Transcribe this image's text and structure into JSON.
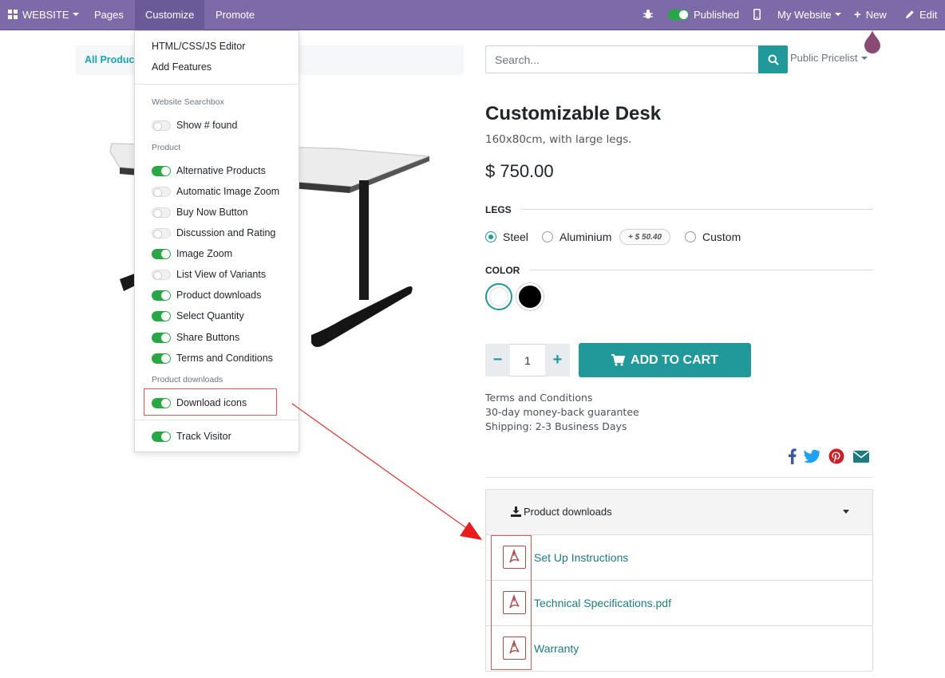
{
  "navbar": {
    "website_menu": "WEBSITE",
    "pages": "Pages",
    "customize": "Customize",
    "promote": "Promote",
    "published": "Published",
    "my_website": "My Website",
    "new": "New",
    "edit": "Edit"
  },
  "breadcrumb": {
    "label": "All Product"
  },
  "customize_menu": {
    "editor": "HTML/CSS/JS Editor",
    "add_features": "Add Features",
    "sections": [
      {
        "header": "Website Searchbox",
        "items": [
          {
            "label": "Show # found",
            "enabled": false
          }
        ]
      },
      {
        "header": "Product",
        "items": [
          {
            "label": "Alternative Products",
            "enabled": true
          },
          {
            "label": "Automatic Image Zoom",
            "enabled": false
          },
          {
            "label": "Buy Now Button",
            "enabled": false
          },
          {
            "label": "Discussion and Rating",
            "enabled": false
          },
          {
            "label": "Image Zoom",
            "enabled": true
          },
          {
            "label": "List View of Variants",
            "enabled": false
          },
          {
            "label": "Product downloads",
            "enabled": true
          },
          {
            "label": "Select Quantity",
            "enabled": true
          },
          {
            "label": "Share Buttons",
            "enabled": true
          },
          {
            "label": "Terms and Conditions",
            "enabled": true
          }
        ]
      },
      {
        "header": "Product downloads",
        "items": [
          {
            "label": "Download icons",
            "enabled": true
          }
        ]
      }
    ],
    "track_visitor": {
      "label": "Track Visitor",
      "enabled": true
    }
  },
  "search": {
    "placeholder": "Search..."
  },
  "pricelist": "Public Pricelist",
  "product": {
    "name": "Customizable Desk",
    "description": "160x80cm, with large legs.",
    "price": "$ 750.00",
    "legs_label": "LEGS",
    "legs_options": [
      {
        "label": "Steel",
        "selected": true
      },
      {
        "label": "Aluminium",
        "selected": false
      },
      {
        "label": "Custom",
        "selected": false
      }
    ],
    "aluminium_extra": "+ $ 50.40",
    "color_label": "COLOR",
    "colors": [
      {
        "hex": "#ffffff",
        "selected": true
      },
      {
        "hex": "#000000",
        "selected": false
      }
    ],
    "quantity": "1",
    "qty_minus": "−",
    "qty_plus": "+",
    "add_to_cart": "ADD TO CART",
    "terms": [
      "Terms and Conditions",
      "30-day money-back guarantee",
      "Shipping: 2-3 Business Days"
    ]
  },
  "share": {
    "facebook": "#3b5998",
    "twitter": "#1da1f2",
    "pinterest": "#cb2027",
    "email": "#1d7a84"
  },
  "downloads": {
    "title": "Product downloads",
    "files": [
      "Set Up Instructions",
      "Technical Specifications.pdf",
      "Warranty"
    ]
  },
  "colors": {
    "navbar": "#7c6ba8",
    "primary": "#21999a",
    "toggle_on": "#28a745",
    "annotation": "#e05555"
  }
}
